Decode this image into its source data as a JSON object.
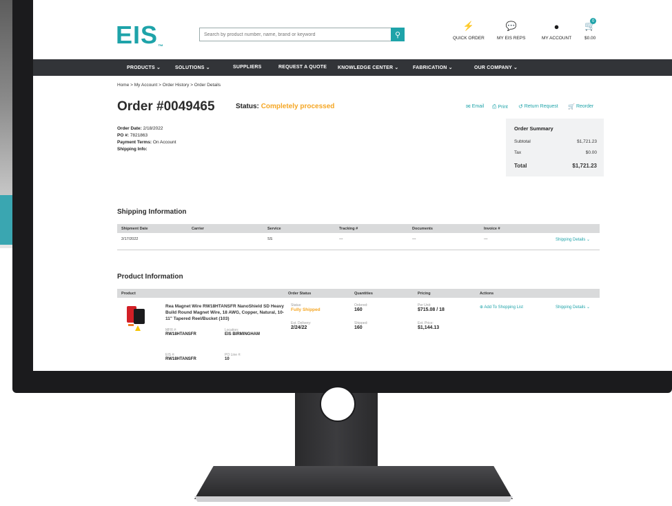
{
  "header": {
    "logo": "EIS",
    "logo_tm": "™",
    "search_placeholder": "Search by product number, name, brand or keyword",
    "quick_order": "QUICK ORDER",
    "my_eis_reps": "MY EIS REPS",
    "my_account": "MY ACCOUNT",
    "cart_total": "$0.00",
    "cart_count": "0"
  },
  "nav": {
    "items": [
      "PRODUCTS ⌄",
      "SOLUTIONS ⌄",
      "SUPPLIERS",
      "REQUEST A QUOTE",
      "KNOWLEDGE CENTER ⌄",
      "FABRICATION ⌄",
      "OUR COMPANY ⌄"
    ]
  },
  "breadcrumb": "Home  >  My Account  >  Order History  >  Order Details",
  "order": {
    "title": "Order #0049465",
    "status_label": "Status:",
    "status_value": "Completely processed",
    "actions": [
      "Email",
      "Print",
      "Return Request",
      "Reorder"
    ],
    "order_date_label": "Order Date:",
    "order_date": "2/18/2022",
    "po_label": "PO #:",
    "po": "7821863",
    "payment_label": "Payment Terms:",
    "payment": "On Account",
    "shipping_info_label": "Shipping Info:"
  },
  "summary": {
    "title": "Order Summary",
    "subtotal_label": "Subtotal",
    "subtotal": "$1,721.23",
    "tax_label": "Tax",
    "tax": "$0.00",
    "total_label": "Total",
    "total": "$1,721.23"
  },
  "shipping": {
    "title": "Shipping Information",
    "columns": [
      "Shipment Date",
      "Carrier",
      "Service",
      "Tracking #",
      "Documents",
      "Invoice #"
    ],
    "row": [
      "2/17/2022",
      "",
      "SS",
      "---",
      "---",
      "---"
    ],
    "details_link": "Shipping Details ⌄"
  },
  "product": {
    "title": "Product Information",
    "columns": [
      "Product",
      "Order Status",
      "Quantities",
      "Pricing",
      "Actions"
    ],
    "name": "Rea Magnet Wire RW18HTANSFR NanoShield SD Heavy Build Round Magnet Wire, 18 AWG, Copper, Natural, 10-11\" Tapered Reel/Bucket (103)",
    "mfr_label": "MFR #:",
    "mfr": "RW18HTANSFR",
    "location_label": "Location:",
    "location": "EIS BIRMINGHAM",
    "eis_label": "EIS #:",
    "eis": "RW18HTANSFR",
    "po_line_label": "PO Line #:",
    "po_line": "10",
    "status_label": "Status:",
    "status": "Fully Shipped",
    "delivery_label": "Est. Delivery:",
    "delivery": "2/24/22",
    "ordered_label": "Ordered:",
    "ordered": "160",
    "shipped_label": "Shipped:",
    "shipped": "160",
    "per_unit_label": "Per Unit:",
    "per_unit": "$715.08 / 18",
    "ext_price_label": "Ext. Price:",
    "ext_price": "$1,144.13",
    "add_list": "Add To Shopping List",
    "details_link": "Shipping Details ⌄"
  }
}
